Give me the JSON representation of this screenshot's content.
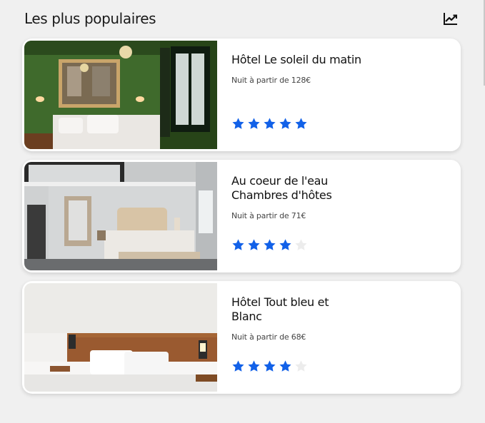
{
  "section": {
    "title": "Les plus populaires",
    "trend_icon": "trending-chart-icon"
  },
  "colors": {
    "star_active": "#1261e8",
    "star_inactive": "#ececec",
    "card_bg": "#ffffff",
    "page_bg": "#f0f0f0"
  },
  "hotels": [
    {
      "name_line1": "Hôtel Le soleil du matin",
      "name_line2": "",
      "price": "Nuit à partir de 128€",
      "rating": 5,
      "max_rating": 5,
      "image": "green-bedroom-photo"
    },
    {
      "name_line1": "Au coeur de l'eau",
      "name_line2": "Chambres d'hôtes",
      "price": "Nuit à partir de 71€",
      "rating": 4,
      "max_rating": 5,
      "image": "loft-bedroom-photo"
    },
    {
      "name_line1": "Hôtel Tout bleu et",
      "name_line2": "Blanc",
      "price": "Nuit à partir de 68€",
      "rating": 4,
      "max_rating": 5,
      "image": "white-bedroom-photo"
    }
  ]
}
